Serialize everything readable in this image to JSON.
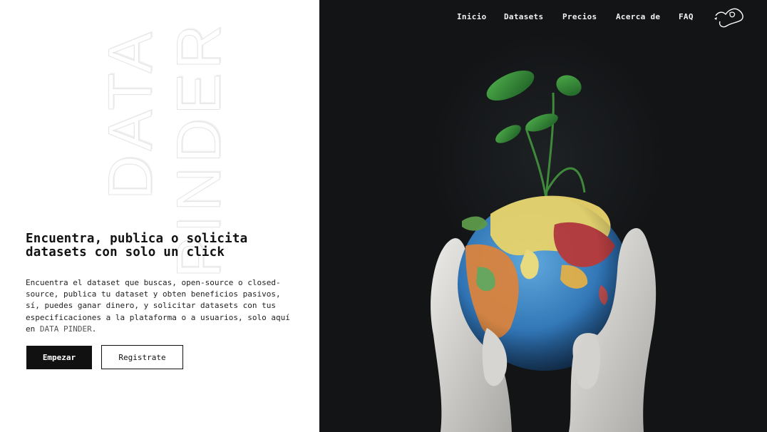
{
  "hero": {
    "watermark_line1": "DATA",
    "watermark_line2": "PINDER",
    "headline": "Encuentra, publica o solicita datasets con solo un click",
    "description": "Encuentra el dataset que buscas, open-source o closed-source, publica tu dataset y obten beneficios pasivos, sí, puedes ganar dinero, y solicitar datasets con tus especificaciones a la plataforma o a usuarios, solo aquí en ",
    "brand_mention": "DATA PINDER",
    "description_end": ".",
    "primary_button": "Empezar",
    "secondary_button": "Registrate"
  },
  "nav": {
    "items": [
      "Inicio",
      "Datasets",
      "Precios",
      "Acerca de",
      "FAQ"
    ],
    "logo_icon": "hand-logo-icon"
  },
  "photo": {
    "subject": "globe-held-in-gloved-hands-with-sprouting-plant"
  },
  "colors": {
    "dark_panel": "#121416",
    "button_primary": "#111111",
    "text": "#111111"
  }
}
